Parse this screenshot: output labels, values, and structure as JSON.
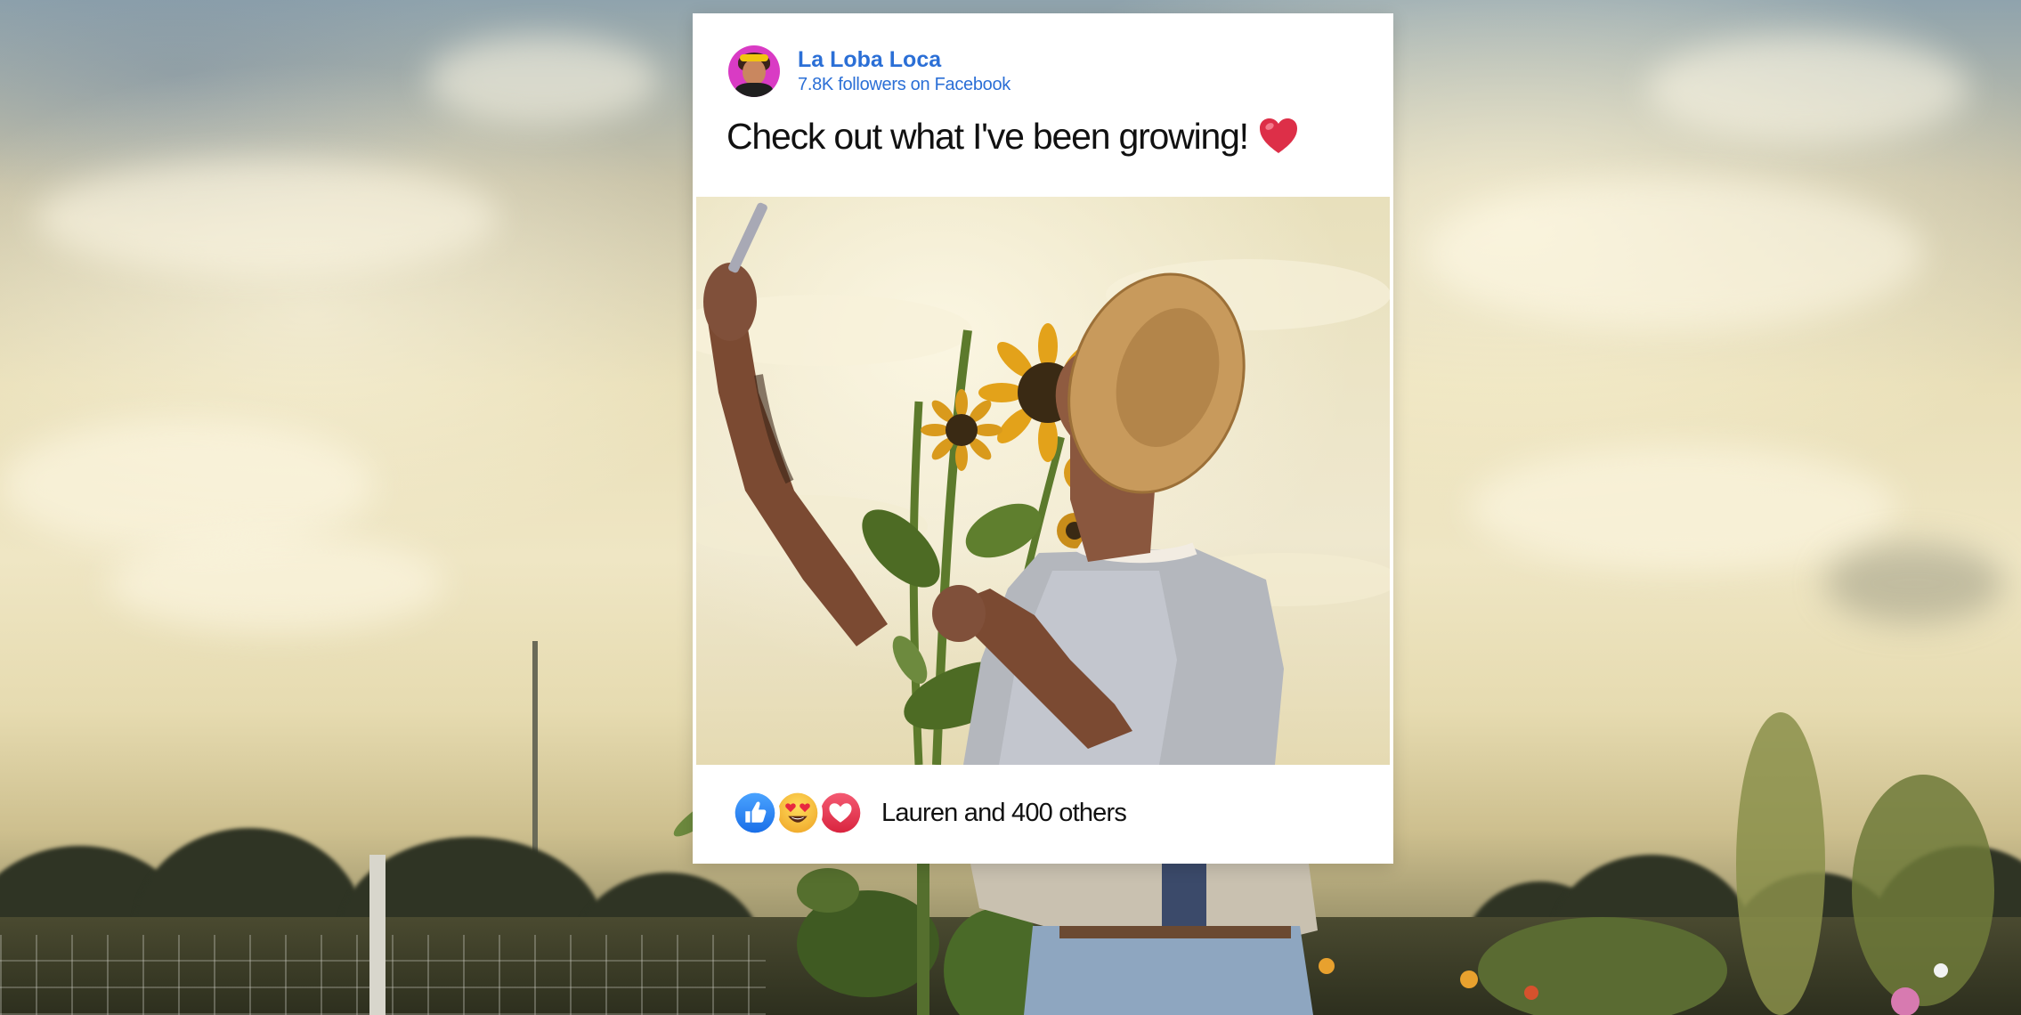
{
  "post": {
    "author": {
      "name": "La Loba Loca",
      "followers": "7.8K followers on Facebook"
    },
    "text": "Check out what I've been growing!",
    "text_emoji": "heart-emoji",
    "reactions": {
      "icons": [
        "like-icon",
        "love-eyes-icon",
        "heart-icon"
      ],
      "summary": "Lauren and 400 others"
    }
  },
  "colors": {
    "author_link": "#2b6fd6",
    "like_blue": "#2d88ff",
    "heart_red": "#e8425a",
    "emoji_yellow": "#f7c13a"
  }
}
